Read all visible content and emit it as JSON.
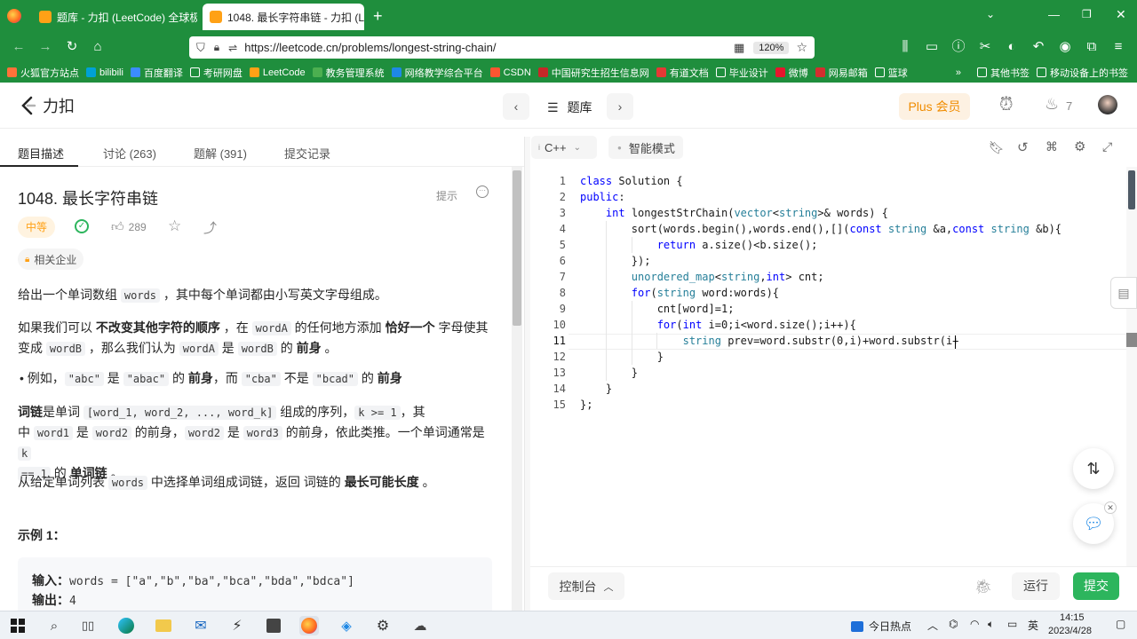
{
  "browser": {
    "tabs": [
      {
        "label": "题库 - 力扣 (LeetCode) 全球极",
        "active": false
      },
      {
        "label": "1048. 最长字符串链 - 力扣 (Le",
        "active": true
      }
    ],
    "url": "https://leetcode.cn/problems/longest-string-chain/",
    "zoom": "120%",
    "bookmarks": [
      "火狐官方站点",
      "bilibili",
      "百度翻译",
      "考研网盘",
      "LeetCode",
      "教务管理系统",
      "网络教学综合平台",
      "CSDN",
      "中国研究生招生信息网",
      "有道文档",
      "毕业设计",
      "微博",
      "网易邮箱",
      "篮球"
    ],
    "bookmarks_right": [
      "其他书签",
      "移动设备上的书签"
    ]
  },
  "header": {
    "logo": "力扣",
    "problem_list": "题库",
    "plus": "Plus 会员",
    "streak": "7"
  },
  "left": {
    "tabs": [
      "题目描述",
      "讨论 (263)",
      "题解 (391)",
      "提交记录"
    ],
    "title": "1048. 最长字符串链",
    "hint": "提示",
    "difficulty": "中等",
    "likes": "289",
    "companies": "相关企业",
    "p1a": "给出一个单词数组 ",
    "p1code": "words",
    "p1b": " ，其中每个单词都由小写英文字母组成。",
    "p2": "如果我们可以 不改变其他字符的顺序 ，在 wordA 的任何地方添加 恰好一个 字母使其变成 wordB ，那么我们认为 wordA 是 wordB 的 前身 。",
    "p2_parts": {
      "a": "如果我们可以 ",
      "b1": "不改变其他字符的顺序",
      "c": " ，在 ",
      "w1": "wordA",
      "d": " 的任何地方添加 ",
      "b2": "恰好一个",
      "e": " 字母使其",
      "f": "变成 ",
      "w2": "wordB",
      "g": " ，那么我们认为 ",
      "w3": "wordA",
      "h": " 是 ",
      "w4": "wordB",
      "i": " 的 ",
      "b3": "前身",
      "j": " 。"
    },
    "example_bullet": {
      "a": "例如，",
      "c1": "\"abc\"",
      "b": " 是 ",
      "c2": "\"abac\"",
      "c": " 的 ",
      "b1": "前身",
      "d": "，而 ",
      "c3": "\"cba\"",
      "e": " 不是 ",
      "c4": "\"bcad\"",
      "f": " 的 ",
      "b2": "前身"
    },
    "p4": {
      "b1": "词链",
      "a": "是单词 ",
      "c1": "[word_1, word_2, ..., word_k]",
      "b": " 组成的序列，",
      "c2": "k >= 1",
      "c": "，其",
      "d": "中 ",
      "c3": "word1",
      "e": " 是 ",
      "c4": "word2",
      "f": " 的前身，",
      "c5": "word2",
      "g": " 是 ",
      "c6": "word3",
      "h": " 的前身，依此类推。一个单词通常是 ",
      "c7": "k",
      "c8": "== 1",
      "i": " 的 ",
      "b2": "单词链",
      "j": " 。"
    },
    "p5": {
      "a": "从给定单词列表 ",
      "c1": "words",
      "b": " 中选择单词组成词链，返回 词链的 ",
      "b1": "最长可能长度",
      "c": " 。"
    },
    "example_title": "示例 1：",
    "example_input_label": "输入：",
    "example_input": "words = [\"a\",\"b\",\"ba\",\"bca\",\"bda\",\"bdca\"]",
    "example_output_label": "输出：",
    "example_output": "4"
  },
  "editor": {
    "language": "C++",
    "mode": "智能模式",
    "lines": [
      "class Solution {",
      "public:",
      "    int longestStrChain(vector<string>& words) {",
      "        sort(words.begin(),words.end(),[](const string &a,const string &b){",
      "            return a.size()<b.size();",
      "        });",
      "        unordered_map<string,int> cnt;",
      "        for(string word:words){",
      "            cnt[word]=1;",
      "            for(int i=0;i<word.size();i++){",
      "                string prev=word.substr(0,i)+word.substr(i+",
      "            }",
      "        }",
      "    }",
      "};"
    ],
    "console": "控制台",
    "run": "运行",
    "submit": "提交"
  },
  "taskbar": {
    "news": "今日热点",
    "ime": "英",
    "time": "14:15",
    "date": "2023/4/28"
  },
  "colors": {
    "browser_green": "#1f8e3d",
    "submit_green": "#2db55d",
    "medium_orange": "#ffa116"
  }
}
